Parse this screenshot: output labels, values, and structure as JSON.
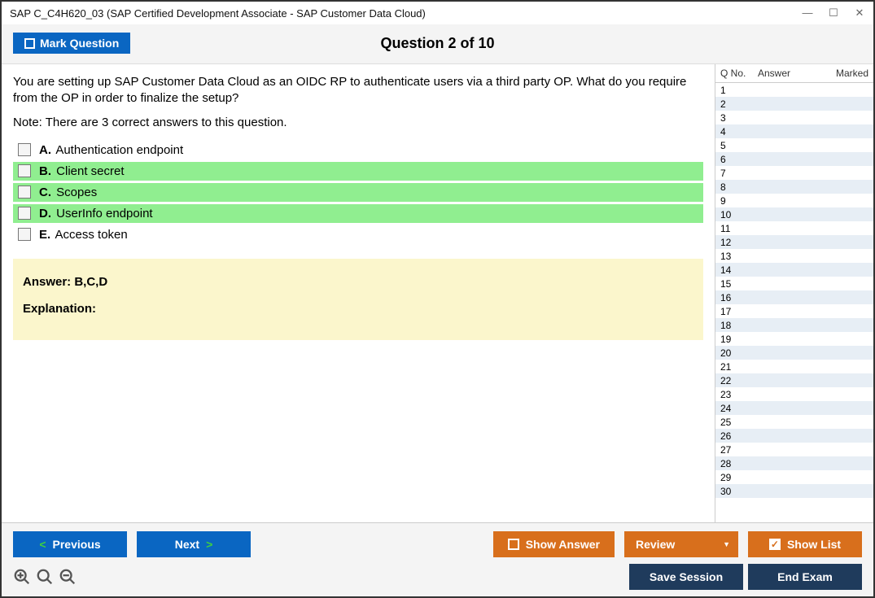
{
  "window": {
    "title": "SAP C_C4H620_03 (SAP Certified Development Associate - SAP Customer Data Cloud)"
  },
  "header": {
    "mark_label": "Mark Question",
    "question_label": "Question 2 of 10"
  },
  "question": {
    "text": "You are setting up SAP Customer Data Cloud as an OIDC RP to authenticate users via a third party OP. What do you require from the OP in order to finalize the setup?",
    "note": "Note: There are 3 correct answers to this question.",
    "options": [
      {
        "letter": "A.",
        "text": "Authentication endpoint",
        "correct": false
      },
      {
        "letter": "B.",
        "text": "Client secret",
        "correct": true
      },
      {
        "letter": "C.",
        "text": "Scopes",
        "correct": true
      },
      {
        "letter": "D.",
        "text": "UserInfo endpoint",
        "correct": true
      },
      {
        "letter": "E.",
        "text": "Access token",
        "correct": false
      }
    ]
  },
  "answer": {
    "label": "Answer: B,C,D",
    "explanation_label": "Explanation:"
  },
  "sidebar": {
    "cols": {
      "qno": "Q No.",
      "answer": "Answer",
      "marked": "Marked"
    },
    "count": 30
  },
  "footer": {
    "previous": "Previous",
    "next": "Next",
    "show_answer": "Show Answer",
    "review": "Review",
    "show_list": "Show List",
    "save_session": "Save Session",
    "end_exam": "End Exam"
  }
}
